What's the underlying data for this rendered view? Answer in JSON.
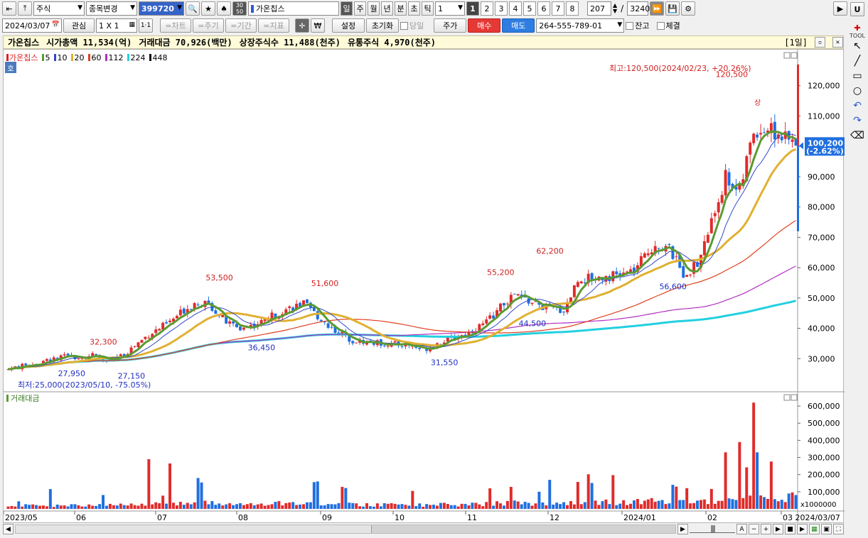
{
  "toolbar1": {
    "market": "주식",
    "change_label": "종목변경",
    "code": "399720",
    "stock_name": "가온칩스",
    "periods": [
      "일",
      "주",
      "월",
      "년",
      "분",
      "초",
      "틱"
    ],
    "interval_value": "1",
    "numbers": [
      "1",
      "2",
      "3",
      "4",
      "5",
      "6",
      "7",
      "8"
    ],
    "count": "207",
    "slash": "/",
    "total": "3240",
    "side_label": "U"
  },
  "toolbar2": {
    "date": "2024/03/07",
    "watch_label": "관심",
    "layout_label": "1 X 1",
    "tabs": [
      "=차트",
      "=주기",
      "=기간",
      "=지표"
    ],
    "settings_label": "설정",
    "reset_label": "초기화",
    "today_label": "당일",
    "price_label": "주가",
    "buy_label": "매수",
    "sell_label": "매도",
    "account": "264-555-789-01",
    "balance_label": "잔고",
    "fill_label": "체결"
  },
  "infobar": {
    "name": "가온칩스",
    "mktcap": "시가총액 11,534(억)",
    "trade_amount": "거래대금 70,926(백만)",
    "listed_shares": "상장주식수 11,488(천주)",
    "float_shares": "유통주식 4,970(천주)",
    "period_tag": "[1일]"
  },
  "legend": {
    "name": "가온칩스",
    "ma": [
      {
        "label": "5",
        "color": "#5a9a32"
      },
      {
        "label": "10",
        "color": "#3348c8"
      },
      {
        "label": "20",
        "color": "#e0b030"
      },
      {
        "label": "60",
        "color": "#e04020"
      },
      {
        "label": "112",
        "color": "#b030c0"
      },
      {
        "label": "224",
        "color": "#22d0e0"
      },
      {
        "label": "448",
        "color": "#111111"
      }
    ],
    "badge": "호"
  },
  "annotations": {
    "high_note": "최고:120,500(2024/02/23, +20.26%)",
    "low_note": "최저:25,000(2023/05/10, -75.05%)",
    "current_price": "100,200",
    "current_change": "(-2.62%)",
    "volume_title": "거래대금",
    "volume_unit": "x1000000",
    "high_marker": "상"
  },
  "chart_data": {
    "type": "candlestick",
    "price_axis": {
      "ylim": [
        20000,
        130000
      ],
      "ticks": [
        "120,000",
        "110,000",
        "100,000",
        "90,000",
        "80,000",
        "70,000",
        "60,000",
        "50,000",
        "40,000",
        "30,000"
      ]
    },
    "volume_axis": {
      "ylim": [
        0,
        650000
      ],
      "ticks": [
        "600,000",
        "500,000",
        "400,000",
        "300,000",
        "200,000",
        "100,000"
      ]
    },
    "x_labels": [
      "2023/05",
      "06",
      "07",
      "08",
      "09",
      "10",
      "11",
      "12",
      "2024/01",
      "02",
      "03 2024/03/07"
    ],
    "peak_labels": [
      {
        "text": "32,300",
        "kind": "high",
        "date": "2023-06-14",
        "price": 32300
      },
      {
        "text": "27,950",
        "kind": "low",
        "date": "2023-06-01",
        "price": 27950
      },
      {
        "text": "27,150",
        "kind": "low",
        "date": "2023-06-26",
        "price": 27150
      },
      {
        "text": "53,500",
        "kind": "high",
        "date": "2023-07-31",
        "price": 53500
      },
      {
        "text": "36,450",
        "kind": "low",
        "date": "2023-08-17",
        "price": 36450
      },
      {
        "text": "51,600",
        "kind": "high",
        "date": "2023-09-12",
        "price": 51600
      },
      {
        "text": "31,550",
        "kind": "low",
        "date": "2023-10-31",
        "price": 31550
      },
      {
        "text": "55,200",
        "kind": "high",
        "date": "2023-11-23",
        "price": 55200
      },
      {
        "text": "44,500",
        "kind": "low",
        "date": "2023-12-05",
        "price": 44500
      },
      {
        "text": "62,200",
        "kind": "high",
        "date": "2023-12-13",
        "price": 62200
      },
      {
        "text": "56,600",
        "kind": "low",
        "date": "2024-02-01",
        "price": 56600
      },
      {
        "text": "120,500",
        "kind": "high",
        "date": "2024-02-23",
        "price": 120500
      }
    ],
    "close_path": [
      [
        0,
        26500
      ],
      [
        8,
        28500
      ],
      [
        16,
        30500
      ],
      [
        24,
        31000
      ],
      [
        28,
        29000
      ],
      [
        33,
        31500
      ],
      [
        40,
        38000
      ],
      [
        46,
        42000
      ],
      [
        50,
        46000
      ],
      [
        54,
        49000
      ],
      [
        58,
        47000
      ],
      [
        62,
        42000
      ],
      [
        66,
        40000
      ],
      [
        72,
        42000
      ],
      [
        78,
        46000
      ],
      [
        84,
        48000
      ],
      [
        88,
        44000
      ],
      [
        92,
        40000
      ],
      [
        98,
        36000
      ],
      [
        106,
        35000
      ],
      [
        114,
        34500
      ],
      [
        118,
        33000
      ],
      [
        124,
        36000
      ],
      [
        130,
        38000
      ],
      [
        136,
        42000
      ],
      [
        140,
        47000
      ],
      [
        144,
        51000
      ],
      [
        148,
        49000
      ],
      [
        152,
        47000
      ],
      [
        158,
        46000
      ],
      [
        162,
        56000
      ],
      [
        168,
        57000
      ],
      [
        174,
        57500
      ],
      [
        178,
        59000
      ],
      [
        184,
        68000
      ],
      [
        188,
        66000
      ],
      [
        192,
        58000
      ],
      [
        196,
        61000
      ],
      [
        200,
        75000
      ],
      [
        204,
        90000
      ],
      [
        208,
        85000
      ],
      [
        212,
        105000
      ],
      [
        216,
        106000
      ],
      [
        220,
        103000
      ],
      [
        224,
        100200
      ]
    ],
    "n_bars": 225,
    "current": 100200
  }
}
